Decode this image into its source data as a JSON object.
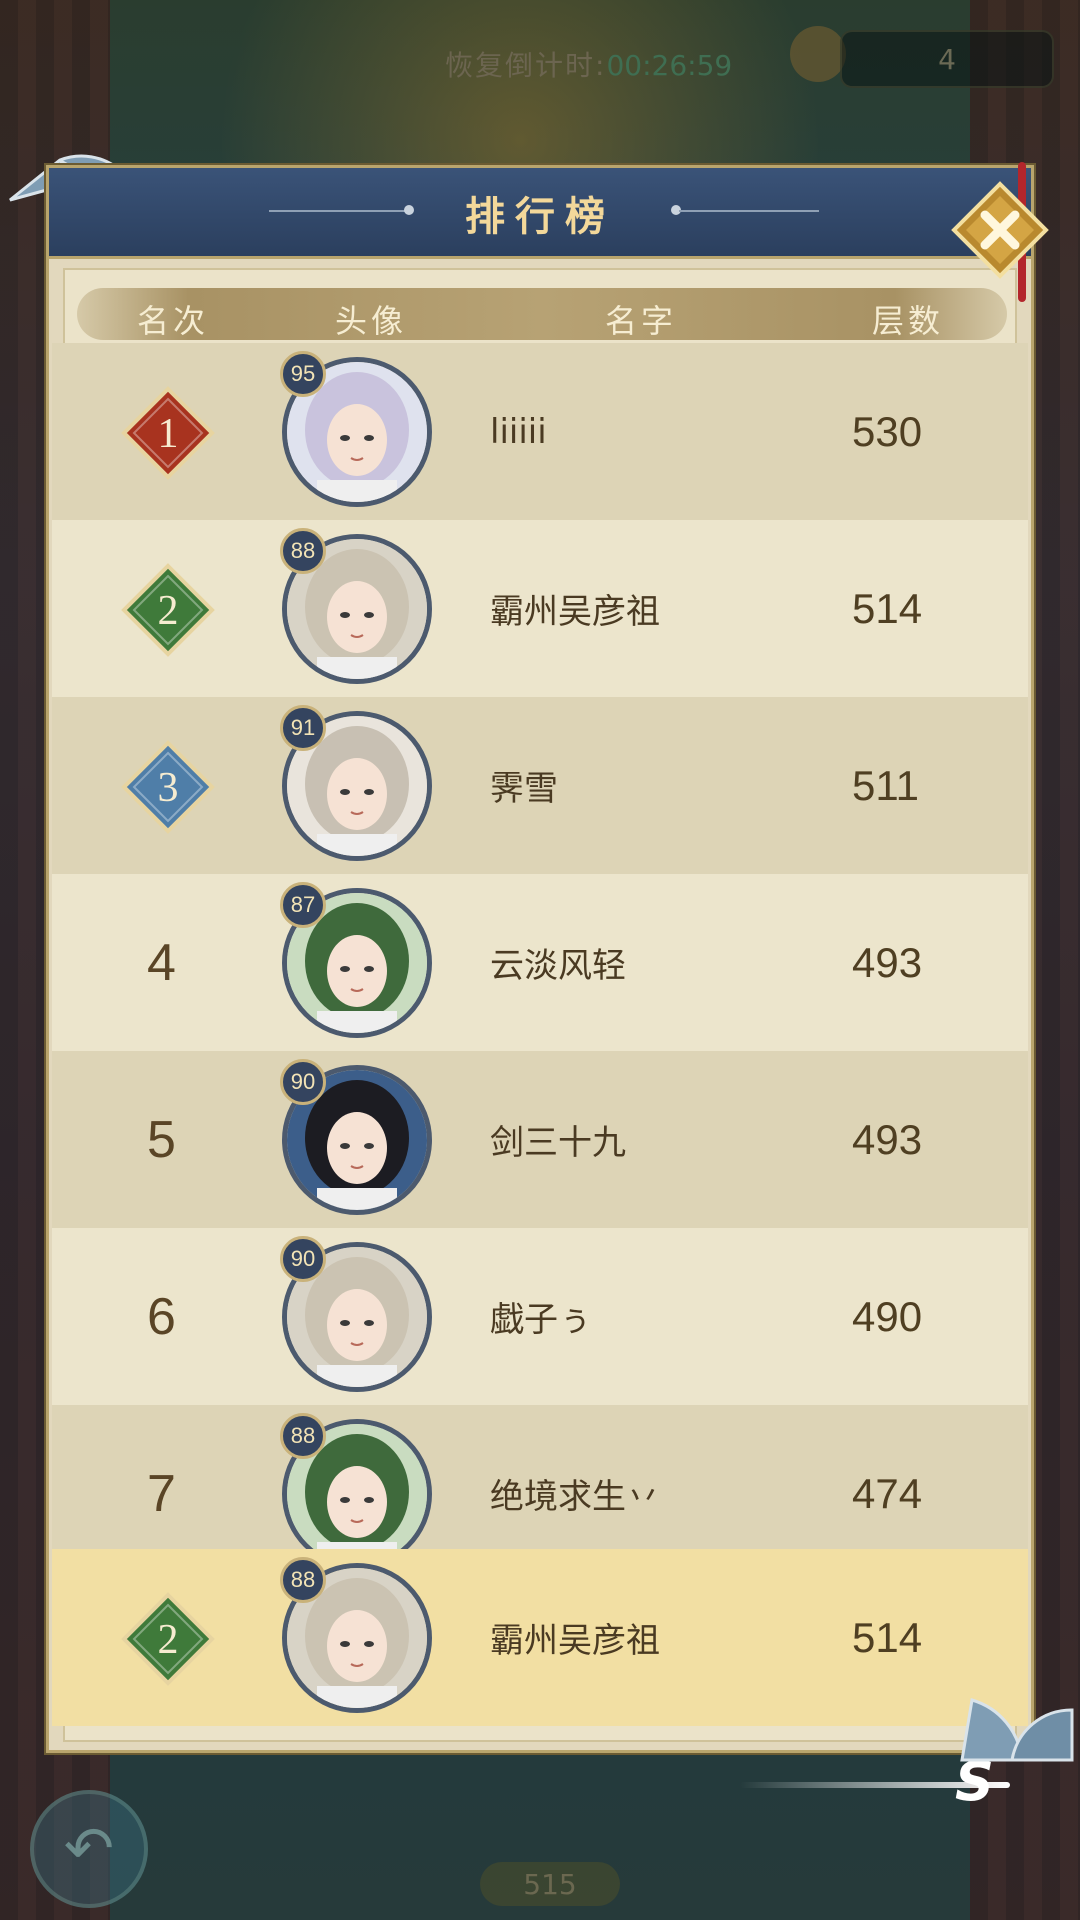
{
  "topbar": {
    "countdown_label": "恢复倒计时:",
    "countdown_time": "00:26:59",
    "counter_value": "4"
  },
  "modal": {
    "title": "排行榜",
    "columns": {
      "rank": "名次",
      "avatar": "头像",
      "name": "名字",
      "floors": "层数"
    }
  },
  "rows": [
    {
      "rank": "1",
      "level": "95",
      "name": "liiiii",
      "floors": "530",
      "badge": "red"
    },
    {
      "rank": "2",
      "level": "88",
      "name": "霸州吴彦祖",
      "floors": "514",
      "badge": "green"
    },
    {
      "rank": "3",
      "level": "91",
      "name": "霁雪",
      "floors": "511",
      "badge": "blue"
    },
    {
      "rank": "4",
      "level": "87",
      "name": "云淡风轻",
      "floors": "493"
    },
    {
      "rank": "5",
      "level": "90",
      "name": "剑三十九",
      "floors": "493"
    },
    {
      "rank": "6",
      "level": "90",
      "name": "戯子ぅ",
      "floors": "490"
    },
    {
      "rank": "7",
      "level": "88",
      "name": "绝境求生丷",
      "floors": "474"
    }
  ],
  "my_rank": {
    "rank": "2",
    "level": "88",
    "name": "霸州吴彦祖",
    "floors": "514",
    "badge": "green"
  },
  "bottom": {
    "floor_label": "515",
    "speed_label": "S"
  },
  "icons": {
    "close": "close-icon",
    "back": "back-arrow-icon",
    "fan": "fan-ornament-icon"
  },
  "colors": {
    "header_bg": "#2b3f5e",
    "title": "#f3d89a",
    "badge_red": "#a8331f",
    "badge_green": "#3f7a3a",
    "badge_blue": "#4f7ea8",
    "highlight_row": "#f2dfa3"
  }
}
